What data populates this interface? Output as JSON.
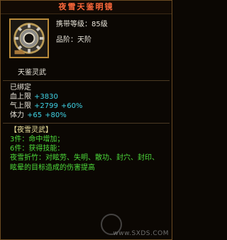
{
  "item": {
    "name": "夜雪天鉴明镜",
    "icon": "mirror-gear-icon",
    "level_label": "携带等级：85级",
    "quality_label": "品阶：天阶",
    "sub_name": "天鉴灵武"
  },
  "stats": {
    "bound": "已绑定",
    "hp": {
      "label": "血上限",
      "value": "+3830"
    },
    "qi": {
      "label": "气上限",
      "value": "+2799",
      "bonus": "+60%"
    },
    "stamina": {
      "label": "体力",
      "value": "+65",
      "bonus": "+80%"
    }
  },
  "set": {
    "title": "【夜雪灵武】",
    "piece3": "3件：命中增加；",
    "piece6": "6件：获得技能：",
    "skill": "夜雪折竹：对眩劳、失明、散功、封穴、封印、眩晕的目标造成的伤害提高"
  },
  "watermark": "www.SXDS.COM",
  "colors": {
    "title": "#ff6a3c",
    "stat": "#3fd3e6",
    "bonus": "#4ddc3a",
    "set_title": "#f0e6a0"
  }
}
